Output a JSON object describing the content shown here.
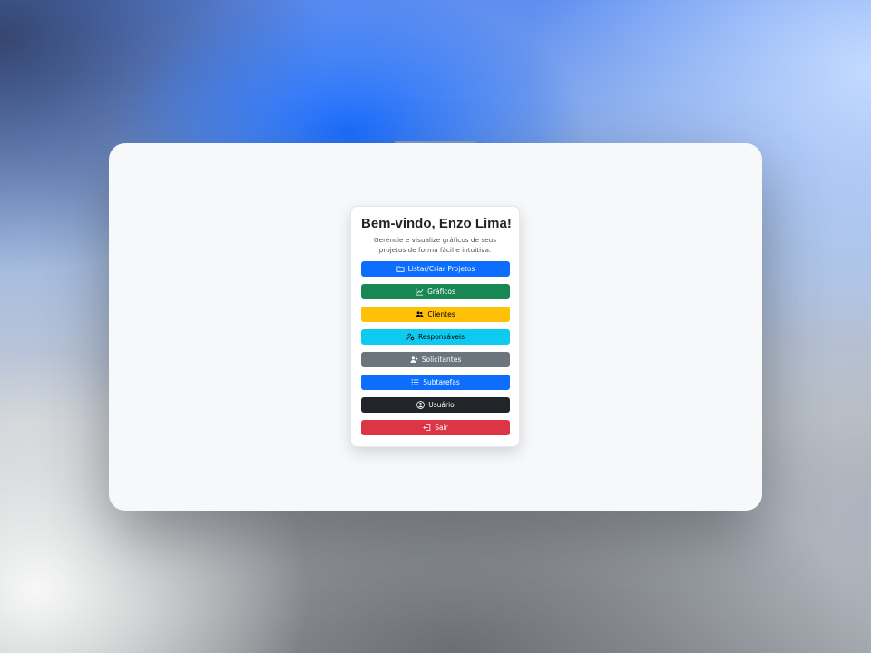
{
  "welcome": {
    "title": "Bem-vindo, Enzo Lima!",
    "subtitle": "Gerencie e visualize gráficos de seus projetos de forma fácil e intuitiva."
  },
  "menu": {
    "items": [
      {
        "label": "Listar/Criar Projetos",
        "icon": "folder-icon",
        "color": "#0d6efd"
      },
      {
        "label": "Gráficos",
        "icon": "line-chart-icon",
        "color": "#198754"
      },
      {
        "label": "Clientes",
        "icon": "people-icon",
        "color": "#ffc107"
      },
      {
        "label": "Responsáveis",
        "icon": "person-gear-icon",
        "color": "#0dcaf0"
      },
      {
        "label": "Solicitantes",
        "icon": "person-plus-icon",
        "color": "#6c757d"
      },
      {
        "label": "Subtarefas",
        "icon": "list-icon",
        "color": "#0d6efd"
      },
      {
        "label": "Usuário",
        "icon": "user-circle-icon",
        "color": "#212529"
      },
      {
        "label": "Sair",
        "icon": "logout-icon",
        "color": "#dc3545"
      }
    ]
  }
}
